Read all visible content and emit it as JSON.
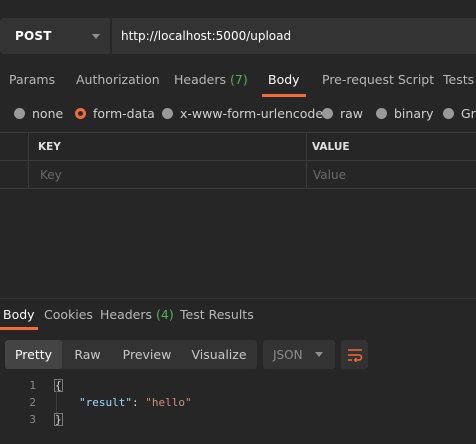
{
  "request": {
    "method": "POST",
    "url": "http://localhost:5000/upload"
  },
  "request_tabs": [
    {
      "label": "Params"
    },
    {
      "label": "Authorization"
    },
    {
      "label": "Headers",
      "count": "(7)"
    },
    {
      "label": "Body",
      "active": true
    },
    {
      "label": "Pre-request Script"
    },
    {
      "label": "Tests"
    }
  ],
  "body_types": [
    {
      "label": "none"
    },
    {
      "label": "form-data",
      "selected": true
    },
    {
      "label": "x-www-form-urlencoded"
    },
    {
      "label": "raw"
    },
    {
      "label": "binary"
    },
    {
      "label": "Gra"
    }
  ],
  "kv_table": {
    "key_header": "KEY",
    "value_header": "VALUE",
    "key_placeholder": "Key",
    "value_placeholder": "Value"
  },
  "response_tabs": [
    {
      "label": "Body",
      "active": true
    },
    {
      "label": "Cookies"
    },
    {
      "label": "Headers",
      "count": "(4)"
    },
    {
      "label": "Test Results"
    }
  ],
  "format_buttons": [
    {
      "label": "Pretty",
      "active": true
    },
    {
      "label": "Raw"
    },
    {
      "label": "Preview"
    },
    {
      "label": "Visualize"
    }
  ],
  "format_select": "JSON",
  "code_lines": [
    {
      "num": "1",
      "open": "{"
    },
    {
      "num": "2",
      "key": "\"result\"",
      "sep": ": ",
      "value": "\"hello\""
    },
    {
      "num": "3",
      "close": "}"
    }
  ],
  "colors": {
    "accent": "#f26b3a",
    "count_green": "#4fb35a",
    "background": "#262626"
  },
  "icons": [
    "chevron-down-icon",
    "radio-icon",
    "wrap-lines-icon"
  ]
}
